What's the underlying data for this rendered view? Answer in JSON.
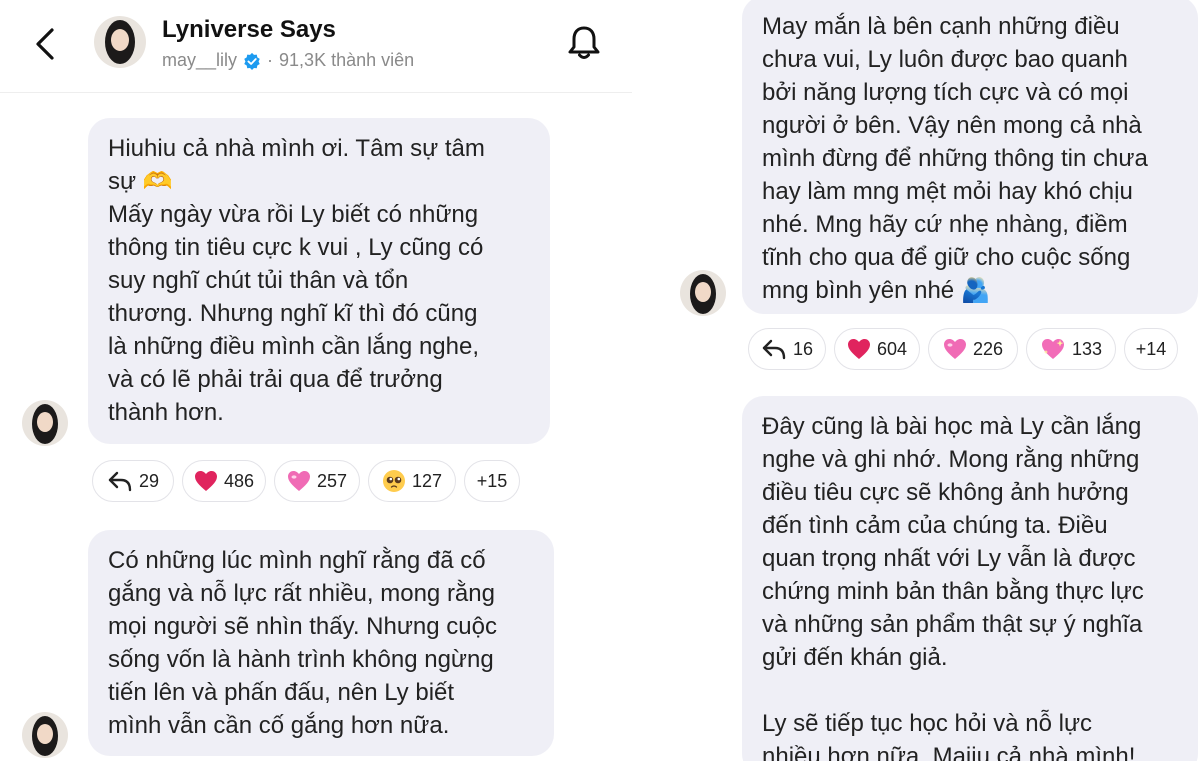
{
  "header": {
    "back_icon": "chevron-left-icon",
    "channel_name": "Lyniverse Says",
    "username": "may__lily",
    "member_count": "91,3K thành viên",
    "bell_icon": "bell-icon"
  },
  "messages_left": [
    {
      "text": "Hiuhiu cả nhà mình ơi. Tâm sự tâm\nsự 🫶\nMấy ngày vừa rồi Ly biết có những\nthông tin tiêu cực k vui , Ly cũng có\nsuy nghĩ chút tủi thân và tổn\nthương. Nhưng nghĩ kĩ thì đó cũng\nlà những điều mình cần lắng nghe,\nvà có lẽ phải trải qua để trưởng\nthành hơn.",
      "reactions": {
        "reply": "29",
        "heart": "486",
        "pink_heart": "257",
        "pleading": "127",
        "more": "+15"
      }
    },
    {
      "text": "Có những lúc mình nghĩ rằng đã cố\ngắng và nỗ lực rất nhiều, mong rằng\nmọi người sẽ nhìn thấy. Nhưng cuộc\nsống vốn là hành trình không ngừng\ntiến lên và phấn đấu, nên Ly biết\nmình vẫn cần cố gắng hơn nữa."
    }
  ],
  "messages_right": [
    {
      "text": "May mắn là bên cạnh những điều\nchưa vui, Ly luôn được bao quanh\nbởi năng lượng tích cực và có mọi\nngười ở bên. Vậy nên mong cả nhà\nmình đừng để những thông tin chưa\nhay làm mng mệt mỏi hay khó chịu\nnhé. Mng hãy cứ nhẹ nhàng, điềm\ntĩnh cho qua để giữ cho cuộc sống\nmng bình yên nhé 🫂",
      "reactions": {
        "reply": "16",
        "heart": "604",
        "pink_heart": "226",
        "sparkling_heart": "133",
        "more": "+14"
      }
    },
    {
      "text": "Đây cũng là bài học mà Ly cần lắng\nnghe và ghi nhớ. Mong rằng những\nđiều tiêu cực sẽ không ảnh hưởng\nđến tình cảm của chúng ta. Điều\nquan trọng nhất với Ly vẫn là được\nchứng minh bản thân bằng thực lực\nvà những sản phẩm thật sự ý nghĩa\ngửi đến khán giả.\n\nLy sẽ tiếp tục học hỏi và nỗ lực\nnhiều hơn nữa. Maiiu cả nhà mình!"
    }
  ],
  "colors": {
    "bubble": "#efeff6",
    "verified": "#1d9bf0",
    "heart": "#e0245e",
    "pink_heart": "#f06bb5"
  }
}
